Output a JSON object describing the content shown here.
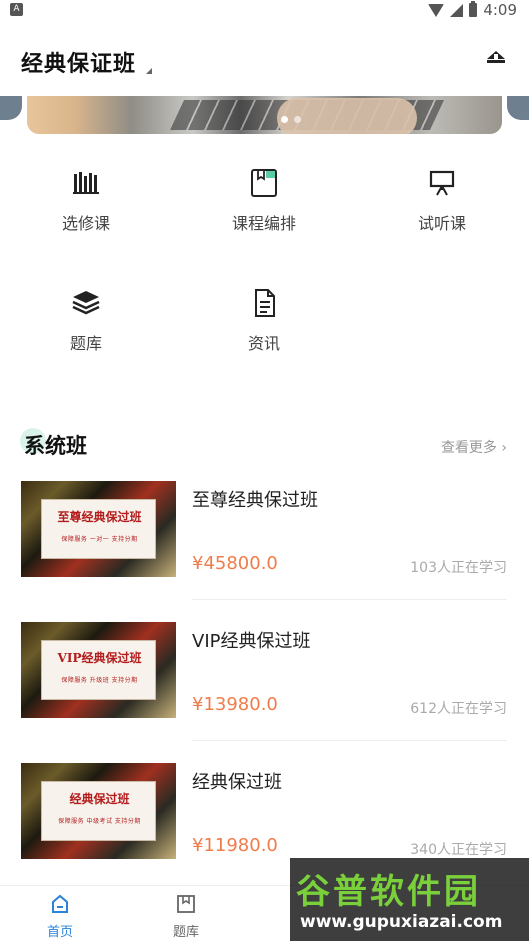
{
  "status_bar": {
    "time": "4:09",
    "notification_letter": "A"
  },
  "header": {
    "title": "经典保证班",
    "action_icon": "shelf-icon"
  },
  "banner": {
    "dots": 2,
    "active_dot": 0
  },
  "menu": {
    "items": [
      {
        "label": "选修课",
        "icon": "books-icon"
      },
      {
        "label": "课程编排",
        "icon": "schedule-icon"
      },
      {
        "label": "试听课",
        "icon": "presentation-icon"
      },
      {
        "label": "题库",
        "icon": "stack-icon"
      },
      {
        "label": "资讯",
        "icon": "document-icon"
      }
    ]
  },
  "section": {
    "title": "系统班",
    "see_more": "查看更多 ›"
  },
  "courses": [
    {
      "name": "至尊经典保过班",
      "price": "¥45800.0",
      "learners": "103人正在学习",
      "thumb_title": "至尊经典保过班",
      "thumb_sub": "保障服务 一对一 支持分期"
    },
    {
      "name": "VIP经典保过班",
      "price": "¥13980.0",
      "learners": "612人正在学习",
      "thumb_title": "VIP经典保过班",
      "thumb_sub": "保障服务 升级班 支持分期"
    },
    {
      "name": "经典保过班",
      "price": "¥11980.0",
      "learners": "340人正在学习",
      "thumb_title": "经典保过班",
      "thumb_sub": "保障服务 中级考试 支持分期"
    }
  ],
  "bottom_nav": {
    "items": [
      {
        "label": "首页",
        "icon": "home-icon",
        "active": true
      },
      {
        "label": "题库",
        "icon": "bookmark-icon",
        "active": false
      }
    ]
  },
  "watermark": {
    "title": "谷普软件园",
    "url": "www.gupuxiazai.com"
  },
  "colors": {
    "accent": "#2a84d8",
    "price": "#f07c4a",
    "section_accent": "#d9f3ea"
  }
}
